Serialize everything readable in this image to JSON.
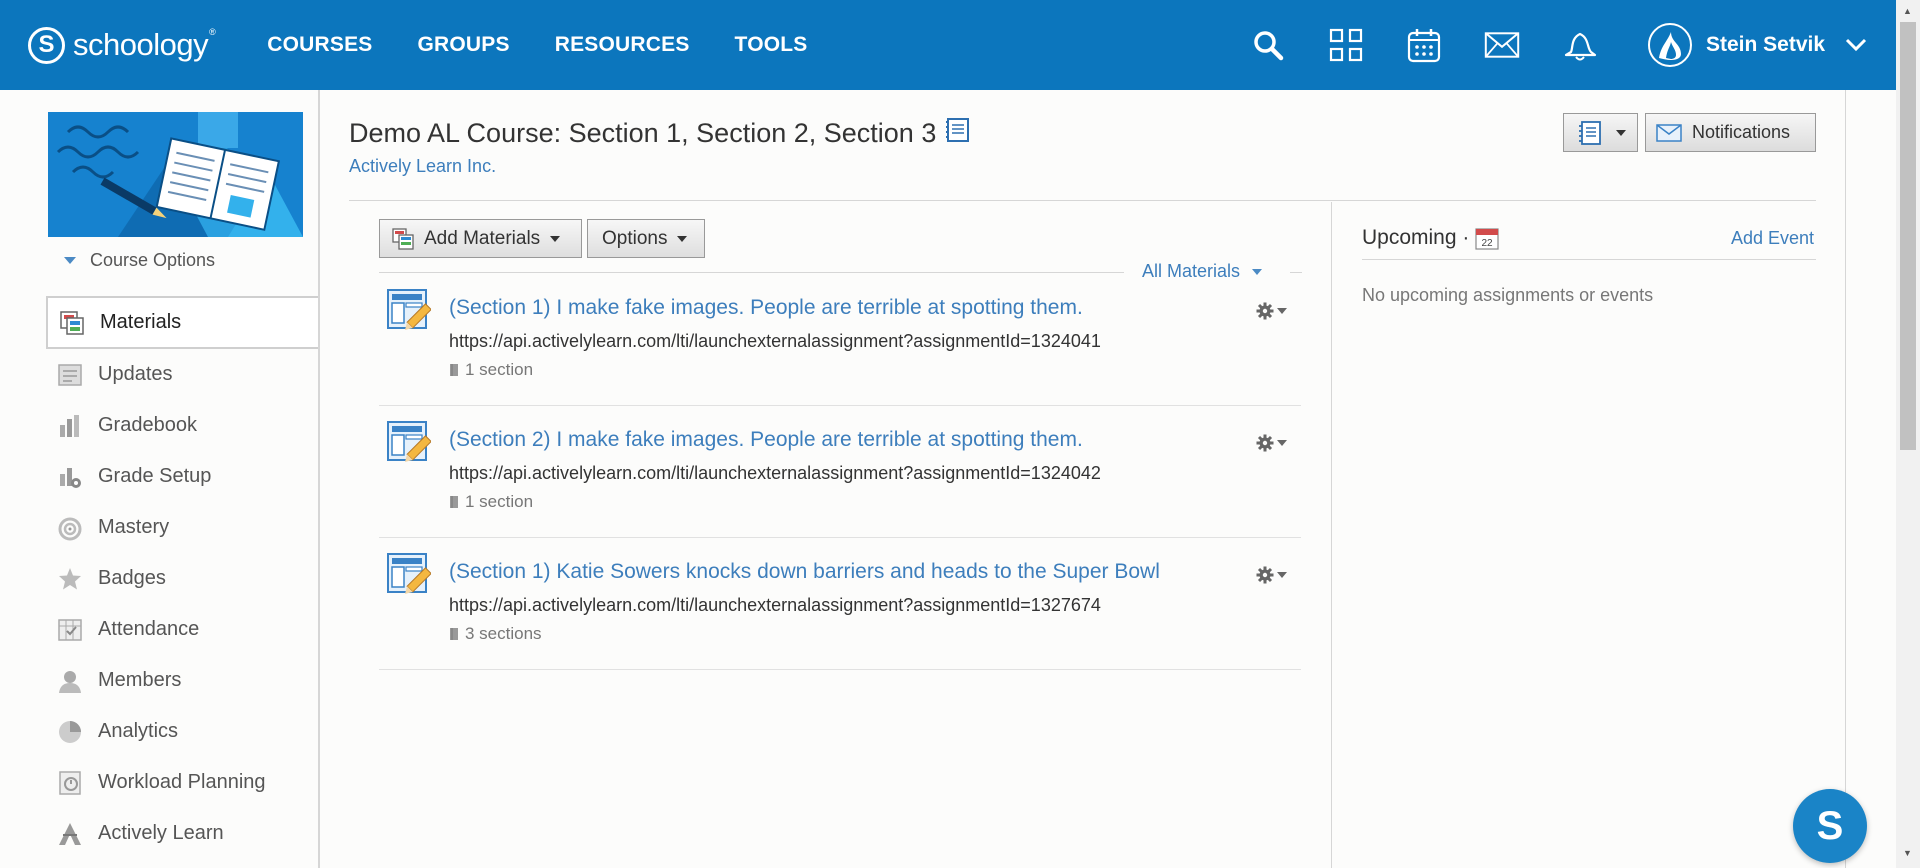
{
  "app": {
    "logo_text": "schoology",
    "logo_mark": "S",
    "logo_reg": "®"
  },
  "nav": {
    "links": [
      "COURSES",
      "GROUPS",
      "RESOURCES",
      "TOOLS"
    ],
    "icons": [
      "search-icon",
      "apps-grid-icon",
      "calendar-icon",
      "mail-icon",
      "bell-icon"
    ],
    "user_name": "Stein Setvik"
  },
  "sidebar": {
    "course_options": "Course Options",
    "items": [
      {
        "label": "Materials",
        "icon": "materials-icon",
        "active": true
      },
      {
        "label": "Updates",
        "icon": "updates-icon"
      },
      {
        "label": "Gradebook",
        "icon": "gradebook-icon"
      },
      {
        "label": "Grade Setup",
        "icon": "grade-setup-icon"
      },
      {
        "label": "Mastery",
        "icon": "mastery-icon"
      },
      {
        "label": "Badges",
        "icon": "badges-icon"
      },
      {
        "label": "Attendance",
        "icon": "attendance-icon"
      },
      {
        "label": "Members",
        "icon": "members-icon"
      },
      {
        "label": "Analytics",
        "icon": "analytics-icon"
      },
      {
        "label": "Workload Planning",
        "icon": "workload-planning-icon"
      },
      {
        "label": "Actively Learn",
        "icon": "actively-learn-icon"
      }
    ]
  },
  "header": {
    "title": "Demo AL Course: Section 1, Section 2, Section 3",
    "school": "Actively Learn Inc.",
    "notifications_label": "Notifications"
  },
  "toolbar": {
    "add_materials_label": "Add Materials",
    "options_label": "Options",
    "filter_label": "All Materials"
  },
  "materials": [
    {
      "title": "(Section 1) I make fake images. People are terrible at spotting them.",
      "url": "https://api.activelylearn.com/lti/launchexternalassignment?assignmentId=1324041",
      "sections": "1 section"
    },
    {
      "title": "(Section 2) I make fake images. People are terrible at spotting them.",
      "url": "https://api.activelylearn.com/lti/launchexternalassignment?assignmentId=1324042",
      "sections": "1 section"
    },
    {
      "title": "(Section 1) Katie Sowers knocks down barriers and heads to the Super Bowl",
      "url": "https://api.activelylearn.com/lti/launchexternalassignment?assignmentId=1327674",
      "sections": "3 sections"
    }
  ],
  "upcoming": {
    "title": "Upcoming ·",
    "calendar_day": "22",
    "add_event": "Add Event",
    "empty": "No upcoming assignments or events"
  },
  "chat": {
    "label": "S"
  },
  "colors": {
    "nav_bg": "#0c76bd",
    "link": "#3d7ebc",
    "chat_bg": "#1a84c7"
  }
}
